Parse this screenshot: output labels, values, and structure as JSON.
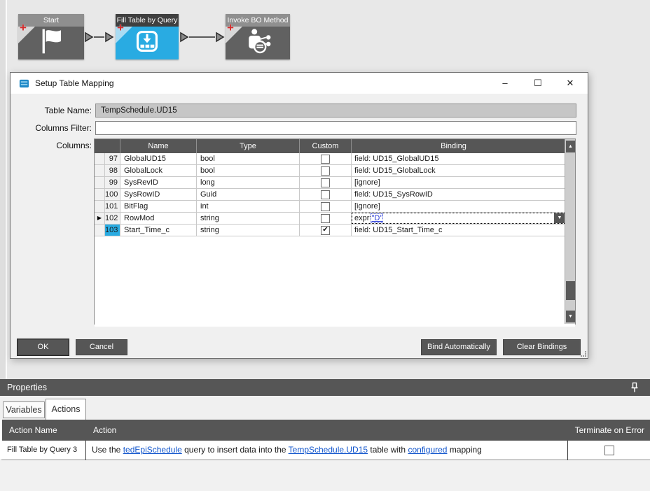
{
  "icons": {
    "minimize": "–",
    "maximize": "☐",
    "close": "✕",
    "up_arrow": "▲",
    "down_arrow": "▼",
    "dropdown": "▼",
    "row_indicator": "▶",
    "check": "✔",
    "plus": "+"
  },
  "colors": {
    "accent_blue": "#29abe2",
    "dark_gray": "#565656",
    "node_gray": "#616161",
    "link_blue": "#1155cc",
    "plus_red": "#d42a2a"
  },
  "workflow": {
    "nodes": [
      {
        "label": "Start"
      },
      {
        "label": "Fill Table by Query"
      },
      {
        "label": "Invoke BO Method"
      }
    ]
  },
  "dialog": {
    "title": "Setup Table Mapping",
    "table_name_label": "Table Name:",
    "table_name_value": "TempSchedule.UD15",
    "columns_filter_label": "Columns Filter:",
    "columns_filter_value": "",
    "columns_label": "Columns:",
    "grid": {
      "headers": [
        "Name",
        "Type",
        "Custom",
        "Binding"
      ],
      "rows": [
        {
          "num": "97",
          "name": "GlobalUD15",
          "type": "bool",
          "custom": false,
          "binding": "field: UD15_GlobalUD15"
        },
        {
          "num": "98",
          "name": "GlobalLock",
          "type": "bool",
          "custom": false,
          "binding": "field: UD15_GlobalLock"
        },
        {
          "num": "99",
          "name": "SysRevID",
          "type": "long",
          "custom": false,
          "binding": "[ignore]"
        },
        {
          "num": "100",
          "name": "SysRowID",
          "type": "Guid",
          "custom": false,
          "binding": "field: UD15_SysRowID"
        },
        {
          "num": "101",
          "name": "BitFlag",
          "type": "int",
          "custom": false,
          "binding": "[ignore]"
        },
        {
          "num": "102",
          "name": "RowMod",
          "type": "string",
          "custom": false,
          "binding_prefix": "expr:",
          "binding_link": "\"D\""
        },
        {
          "num": "103",
          "name": "Start_Time_c",
          "type": "string",
          "custom": true,
          "binding": "field: UD15_Start_Time_c"
        }
      ]
    },
    "buttons": {
      "ok": "OK",
      "cancel": "Cancel",
      "bind_automatically": "Bind Automatically",
      "clear_bindings": "Clear Bindings"
    }
  },
  "properties": {
    "title": "Properties",
    "tabs": [
      {
        "label": "Variables"
      },
      {
        "label": "Actions"
      }
    ],
    "grid": {
      "headers": [
        "Action Name",
        "Action",
        "Terminate on Error"
      ],
      "row": {
        "action_name": "Fill Table by Query 3",
        "action_parts": [
          {
            "text": "Use the "
          },
          {
            "text": "tedEpiSchedule"
          },
          {
            "text": " query to insert data into the "
          },
          {
            "text": "TempSchedule.UD15"
          },
          {
            "text": " table with "
          },
          {
            "text": "configured"
          },
          {
            "text": " mapping"
          }
        ],
        "terminate_checked": false
      }
    }
  }
}
